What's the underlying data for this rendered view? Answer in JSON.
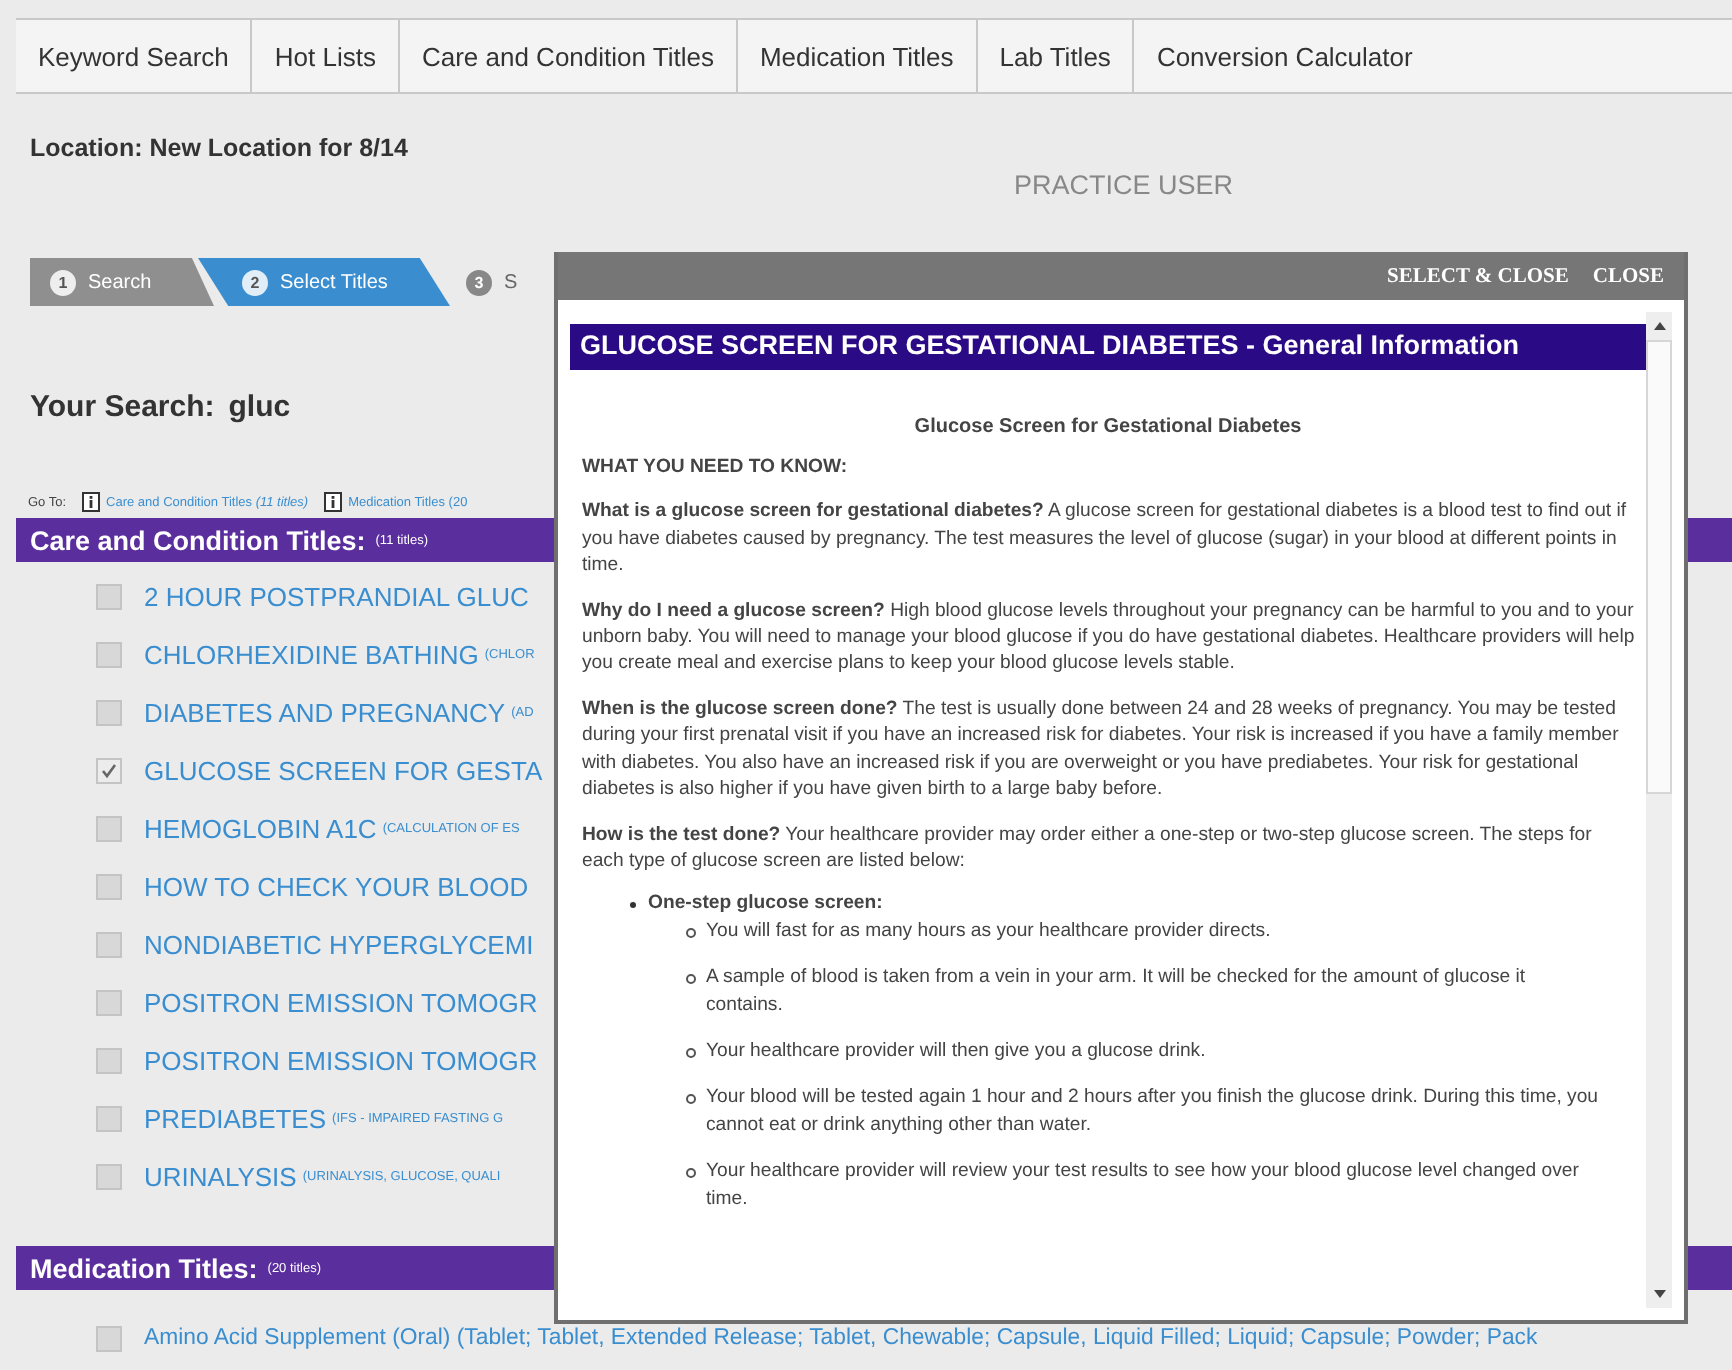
{
  "tabs": [
    {
      "label": "Keyword Search"
    },
    {
      "label": "Hot Lists"
    },
    {
      "label": "Care and Condition Titles"
    },
    {
      "label": "Medication Titles"
    },
    {
      "label": "Lab Titles"
    },
    {
      "label": "Conversion Calculator"
    }
  ],
  "location": "Location:  New Location for 8/14",
  "user": "PRACTICE USER",
  "steps": [
    {
      "number": "1",
      "label": "Search",
      "completed": true,
      "selected": false
    },
    {
      "number": "2",
      "label": "Select Titles",
      "completed": false,
      "selected": true
    },
    {
      "number": "3",
      "label": "S",
      "completed": false,
      "selected": false
    }
  ],
  "search": {
    "label": "Your Search:",
    "term": "gluc"
  },
  "goto": {
    "label": "Go To:",
    "links": [
      "Care and Condition Titles *(11 titles)*",
      "Medication Titles (20"
    ]
  },
  "care_section": {
    "title": "Care and Condition Titles:",
    "count": "(11 titles)",
    "items": [
      {
        "title": "2 HOUR POSTPRANDIAL GLUC",
        "checked": false
      },
      {
        "title": "CHLORHEXIDINE BATHING",
        "detail": "(CHLOR",
        "checked": false
      },
      {
        "title": "DIABETES AND PREGNANCY",
        "detail": "(AD",
        "checked": false
      },
      {
        "title": "GLUCOSE SCREEN FOR GESTA",
        "checked": true
      },
      {
        "title": "HEMOGLOBIN A1C",
        "detail": "(CALCULATION OF ES",
        "checked": false
      },
      {
        "title": "HOW TO CHECK YOUR BLOOD",
        "checked": false
      },
      {
        "title": "NONDIABETIC HYPERGLYCEMI",
        "checked": false
      },
      {
        "title": "POSITRON EMISSION TOMOGR",
        "checked": false
      },
      {
        "title": "POSITRON EMISSION TOMOGR",
        "checked": false
      },
      {
        "title": "PREDIABETES",
        "detail": "(IFS - IMPAIRED FASTING G",
        "checked": false
      },
      {
        "title": "URINALYSIS",
        "detail": "(URINALYSIS, GLUCOSE, QUALI",
        "checked": false
      }
    ]
  },
  "medication_section": {
    "title": "Medication Titles:",
    "count": "(20 titles)",
    "items": [
      {
        "title": "Amino Acid Supplement (Oral) (Tablet; Tablet, Extended Release; Tablet, Chewable; Capsule, Liquid Filled; Liquid; Capsule; Powder; Pack",
        "checked": false
      }
    ]
  },
  "modal": {
    "actions": [
      "SELECT & CLOSE",
      "CLOSE"
    ],
    "title": "GLUCOSE SCREEN FOR GESTATIONAL DIABETES - General Information",
    "doc_title": "Glucose Screen for Gestational Diabetes",
    "heading": "WHAT YOU NEED TO KNOW:",
    "paragraphs": [
      "**What is a glucose screen for gestational diabetes?** A glucose screen for gestational diabetes is a blood test to find out if you have diabetes caused by pregnancy. The test measures the level of glucose (sugar) in your blood at different points in time.",
      "**Why do I need a glucose screen?** High blood glucose levels throughout your pregnancy can be harmful to you and to your unborn baby. You will need to manage your blood glucose if you do have gestational diabetes. Healthcare providers will help you create meal and exercise plans to keep your blood glucose levels stable.",
      "**When is the glucose screen done?** The test is usually done between 24 and 28 weeks of pregnancy. You may be tested during your first prenatal visit if you have an increased risk for diabetes. Your risk is increased if you have a family member with diabetes. You also have an increased risk if you are overweight or you have prediabetes. Your risk for gestational diabetes is also higher if you have given birth to a large baby before.",
      "**How is the test done?** Your healthcare provider may order either a one-step or two-step glucose screen. The steps for each type of glucose screen are listed below:"
    ],
    "list": {
      "heading": "One-step glucose screen:",
      "items": [
        "You will fast for as many hours as your healthcare provider directs.",
        "A sample of blood is taken from a vein in your arm. It will be checked for the amount of glucose it contains.",
        "Your healthcare provider will then give you a glucose drink.",
        "Your blood will be tested again 1 hour and 2 hours after you finish the glucose drink. During this time, you cannot eat or drink anything other than water.",
        "Your healthcare provider will review your test results to see how your blood glucose level changed over time."
      ]
    }
  }
}
